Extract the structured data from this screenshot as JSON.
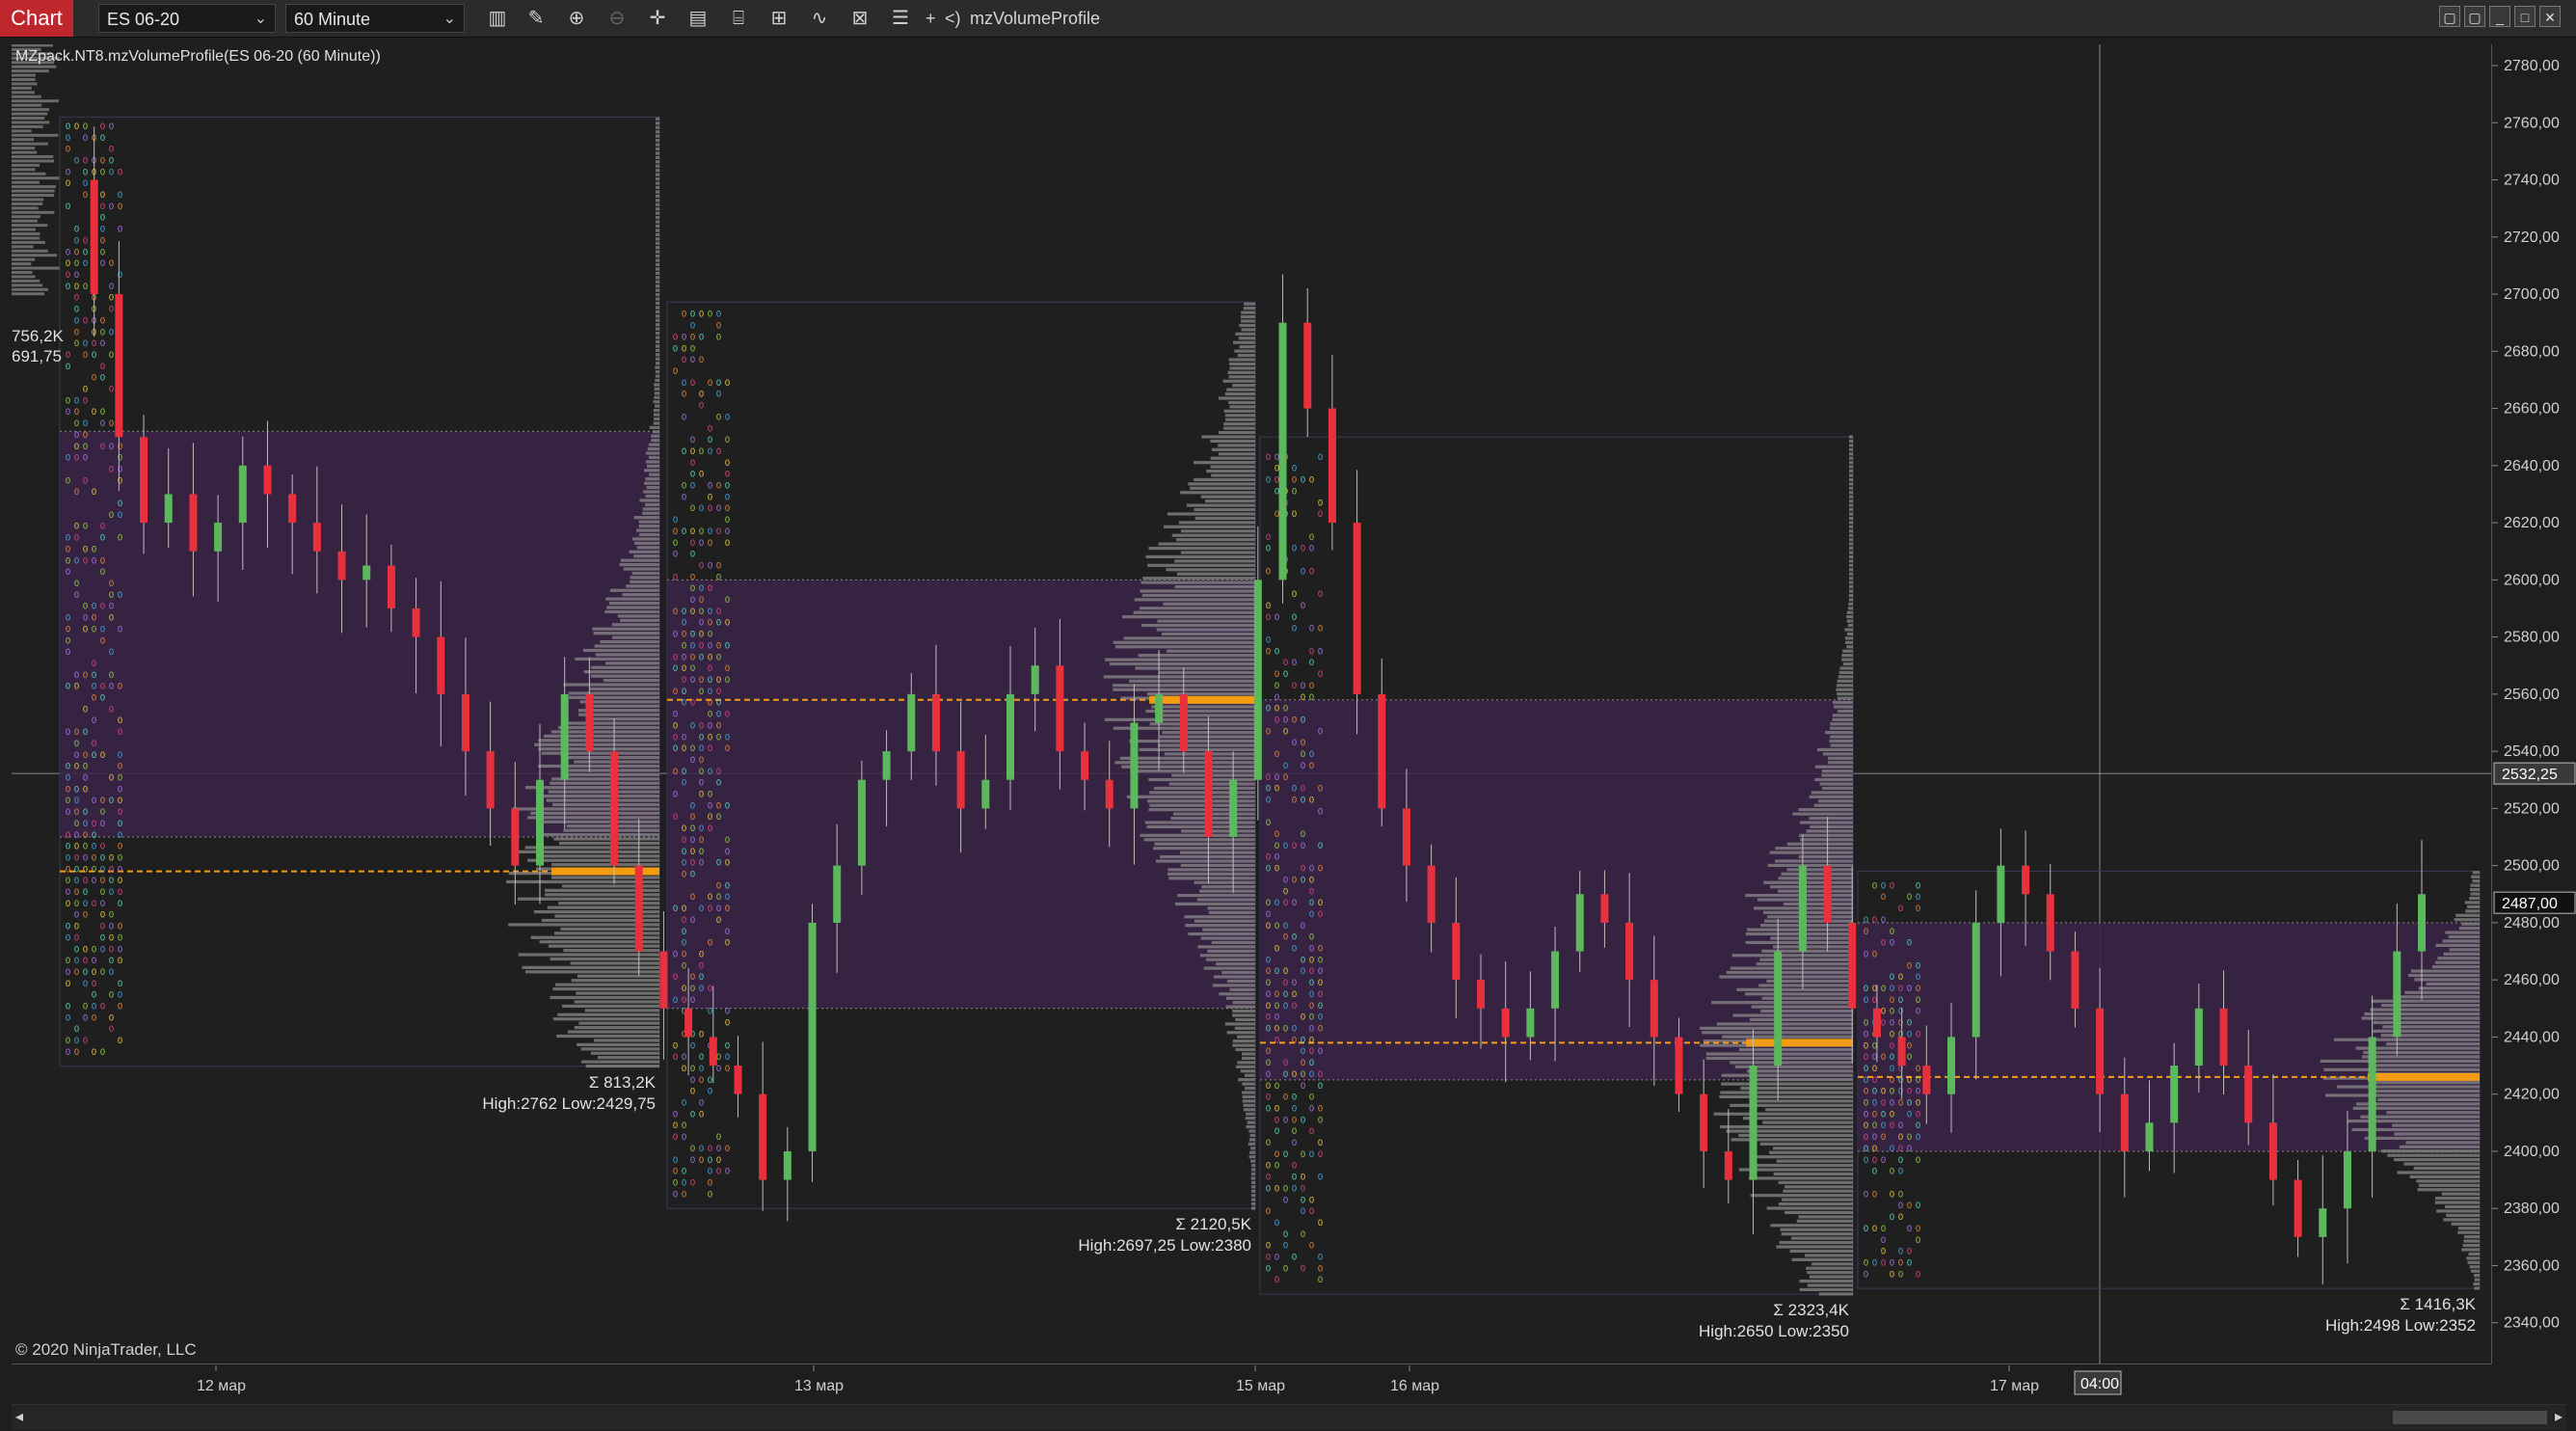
{
  "toolbar": {
    "chart_tab": "Chart",
    "instrument": "ES 06-20",
    "interval": "60 Minute",
    "plus_label": "+",
    "back_label": "<)",
    "indicator_name": "mzVolumeProfile"
  },
  "chart": {
    "indicator_label": "MZpack.NT8.mzVolumeProfile(ES 06-20 (60 Minute))",
    "copyright": "© 2020 NinjaTrader, LLC",
    "side_volume": "756,2K",
    "side_price": "691,75",
    "current_price_tag": "2532,25",
    "last_price_tag": "2487,00",
    "crosshair_time": "04:00"
  },
  "colors": {
    "background": "#1f1f1f",
    "bull_candle": "#5cb85c",
    "bear_candle": "#e8313d",
    "poc_line": "#f39c12",
    "value_area": "#3a2448",
    "profile_bars": "#8a8a8a"
  },
  "price_axis": {
    "ticks": [
      "2780,00",
      "2760,00",
      "2740,00",
      "2720,00",
      "2700,00",
      "2680,00",
      "2660,00",
      "2640,00",
      "2620,00",
      "2600,00",
      "2580,00",
      "2560,00",
      "2540,00",
      "2520,00",
      "2500,00",
      "2480,00",
      "2460,00",
      "2440,00",
      "2420,00",
      "2400,00",
      "2380,00",
      "2360,00",
      "2340,00"
    ]
  },
  "time_axis": {
    "labels": [
      "12 мар",
      "13 мар",
      "15 мар",
      "16 мар",
      "17 мар"
    ]
  },
  "profiles": [
    {
      "sum": "Σ 813,2K",
      "range": "High:2762 Low:2429,75"
    },
    {
      "sum": "Σ 2120,5K",
      "range": "High:2697,25 Low:2380"
    },
    {
      "sum": "Σ 2323,4K",
      "range": "High:2650 Low:2350"
    },
    {
      "sum": "Σ 1416,3K",
      "range": "High:2498 Low:2352"
    }
  ]
}
